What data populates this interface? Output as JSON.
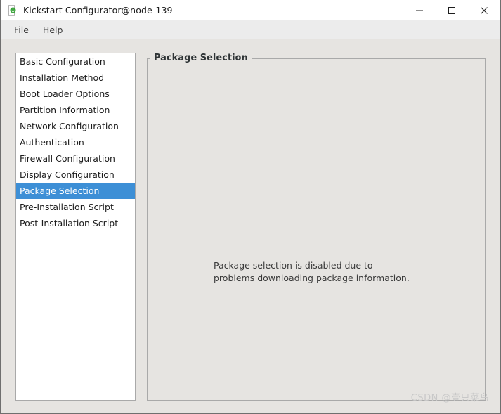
{
  "window": {
    "title": "Kickstart Configurator@node-139",
    "app_icon": "kickstart-app-icon",
    "controls": {
      "minimize": "minimize-icon",
      "maximize": "maximize-icon",
      "close": "close-icon"
    }
  },
  "menubar": {
    "items": [
      {
        "label": "File"
      },
      {
        "label": "Help"
      }
    ]
  },
  "sidebar": {
    "items": [
      {
        "label": "Basic Configuration",
        "selected": false
      },
      {
        "label": "Installation Method",
        "selected": false
      },
      {
        "label": "Boot Loader Options",
        "selected": false
      },
      {
        "label": "Partition Information",
        "selected": false
      },
      {
        "label": "Network Configuration",
        "selected": false
      },
      {
        "label": "Authentication",
        "selected": false
      },
      {
        "label": "Firewall Configuration",
        "selected": false
      },
      {
        "label": "Display Configuration",
        "selected": false
      },
      {
        "label": "Package Selection",
        "selected": true
      },
      {
        "label": "Pre-Installation Script",
        "selected": false
      },
      {
        "label": "Post-Installation Script",
        "selected": false
      }
    ],
    "selected_label": "Package Selection"
  },
  "panel": {
    "legend": "Package Selection",
    "message_line1": "Package selection is disabled due to",
    "message_line2": "problems downloading package information."
  },
  "watermark": {
    "text": "CSDN @壹只菜鸟"
  },
  "colors": {
    "accent_selection": "#3d8fd6",
    "window_background": "#e6e4e1",
    "titlebar_background": "#ffffff",
    "menubar_background": "#ececec",
    "list_background": "#ffffff",
    "border": "#a9a9a9",
    "text": "#1c1c1c",
    "muted_text": "#3a3a3a",
    "watermark_text": "#c8c8c8"
  }
}
